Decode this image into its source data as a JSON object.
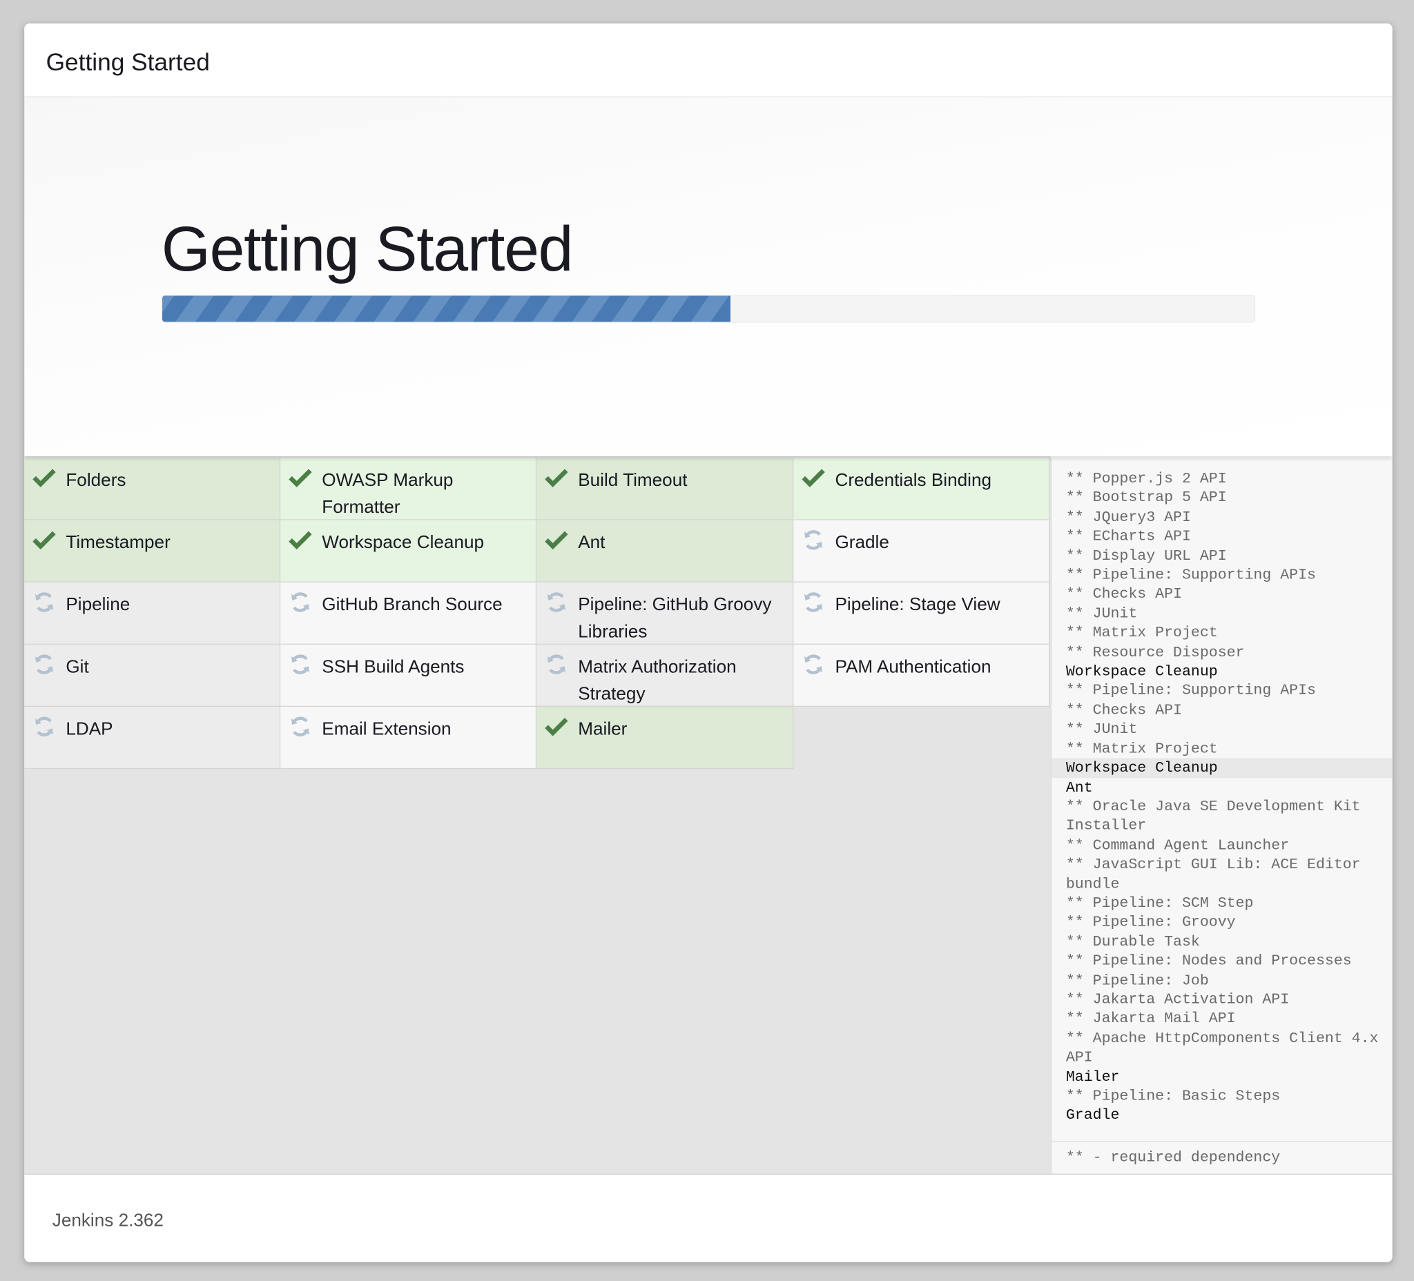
{
  "header": {
    "title": "Getting Started"
  },
  "hero": {
    "title": "Getting Started",
    "progress_percent": 52,
    "colors": {
      "bar": "#4a7ab3",
      "success": "#dcead6",
      "pending": "#ececec"
    }
  },
  "plugins": [
    {
      "name": "Folders",
      "status": "success"
    },
    {
      "name": "OWASP Markup Formatter",
      "status": "success"
    },
    {
      "name": "Build Timeout",
      "status": "success"
    },
    {
      "name": "Credentials Binding",
      "status": "success"
    },
    {
      "name": "Timestamper",
      "status": "success"
    },
    {
      "name": "Workspace Cleanup",
      "status": "success"
    },
    {
      "name": "Ant",
      "status": "success"
    },
    {
      "name": "Gradle",
      "status": "pending"
    },
    {
      "name": "Pipeline",
      "status": "pending"
    },
    {
      "name": "GitHub Branch Source",
      "status": "pending"
    },
    {
      "name": "Pipeline: GitHub Groovy Libraries",
      "status": "pending"
    },
    {
      "name": "Pipeline: Stage View",
      "status": "pending"
    },
    {
      "name": "Git",
      "status": "pending"
    },
    {
      "name": "SSH Build Agents",
      "status": "pending"
    },
    {
      "name": "Matrix Authorization Strategy",
      "status": "pending"
    },
    {
      "name": "PAM Authentication",
      "status": "pending"
    },
    {
      "name": "LDAP",
      "status": "pending"
    },
    {
      "name": "Email Extension",
      "status": "pending"
    },
    {
      "name": "Mailer",
      "status": "success"
    }
  ],
  "log": {
    "lines": [
      {
        "text": "** Popper.js 2 API",
        "dep": true
      },
      {
        "text": "** Bootstrap 5 API",
        "dep": true
      },
      {
        "text": "** JQuery3 API",
        "dep": true
      },
      {
        "text": "** ECharts API",
        "dep": true
      },
      {
        "text": "** Display URL API",
        "dep": true
      },
      {
        "text": "** Pipeline: Supporting APIs",
        "dep": true
      },
      {
        "text": "** Checks API",
        "dep": true
      },
      {
        "text": "** JUnit",
        "dep": true
      },
      {
        "text": "** Matrix Project",
        "dep": true
      },
      {
        "text": "** Resource Disposer",
        "dep": true
      },
      {
        "text": "Workspace Cleanup",
        "dep": false
      },
      {
        "text": "** Pipeline: Supporting APIs",
        "dep": true
      },
      {
        "text": "** Checks API",
        "dep": true
      },
      {
        "text": "** JUnit",
        "dep": true
      },
      {
        "text": "** Matrix Project",
        "dep": true
      },
      {
        "text": "Workspace Cleanup",
        "dep": false,
        "highlight": true
      },
      {
        "text": "Ant",
        "dep": false
      },
      {
        "text": "** Oracle Java SE Development Kit Installer",
        "dep": true
      },
      {
        "text": "** Command Agent Launcher",
        "dep": true
      },
      {
        "text": "** JavaScript GUI Lib: ACE Editor bundle",
        "dep": true
      },
      {
        "text": "** Pipeline: SCM Step",
        "dep": true
      },
      {
        "text": "** Pipeline: Groovy",
        "dep": true
      },
      {
        "text": "** Durable Task",
        "dep": true
      },
      {
        "text": "** Pipeline: Nodes and Processes",
        "dep": true
      },
      {
        "text": "** Pipeline: Job",
        "dep": true
      },
      {
        "text": "** Jakarta Activation API",
        "dep": true
      },
      {
        "text": "** Jakarta Mail API",
        "dep": true
      },
      {
        "text": "** Apache HttpComponents Client 4.x API",
        "dep": true
      },
      {
        "text": "Mailer",
        "dep": false
      },
      {
        "text": "** Pipeline: Basic Steps",
        "dep": true
      },
      {
        "text": "Gradle",
        "dep": false
      }
    ],
    "legend": "** - required dependency"
  },
  "footer": {
    "version": "Jenkins 2.362"
  }
}
